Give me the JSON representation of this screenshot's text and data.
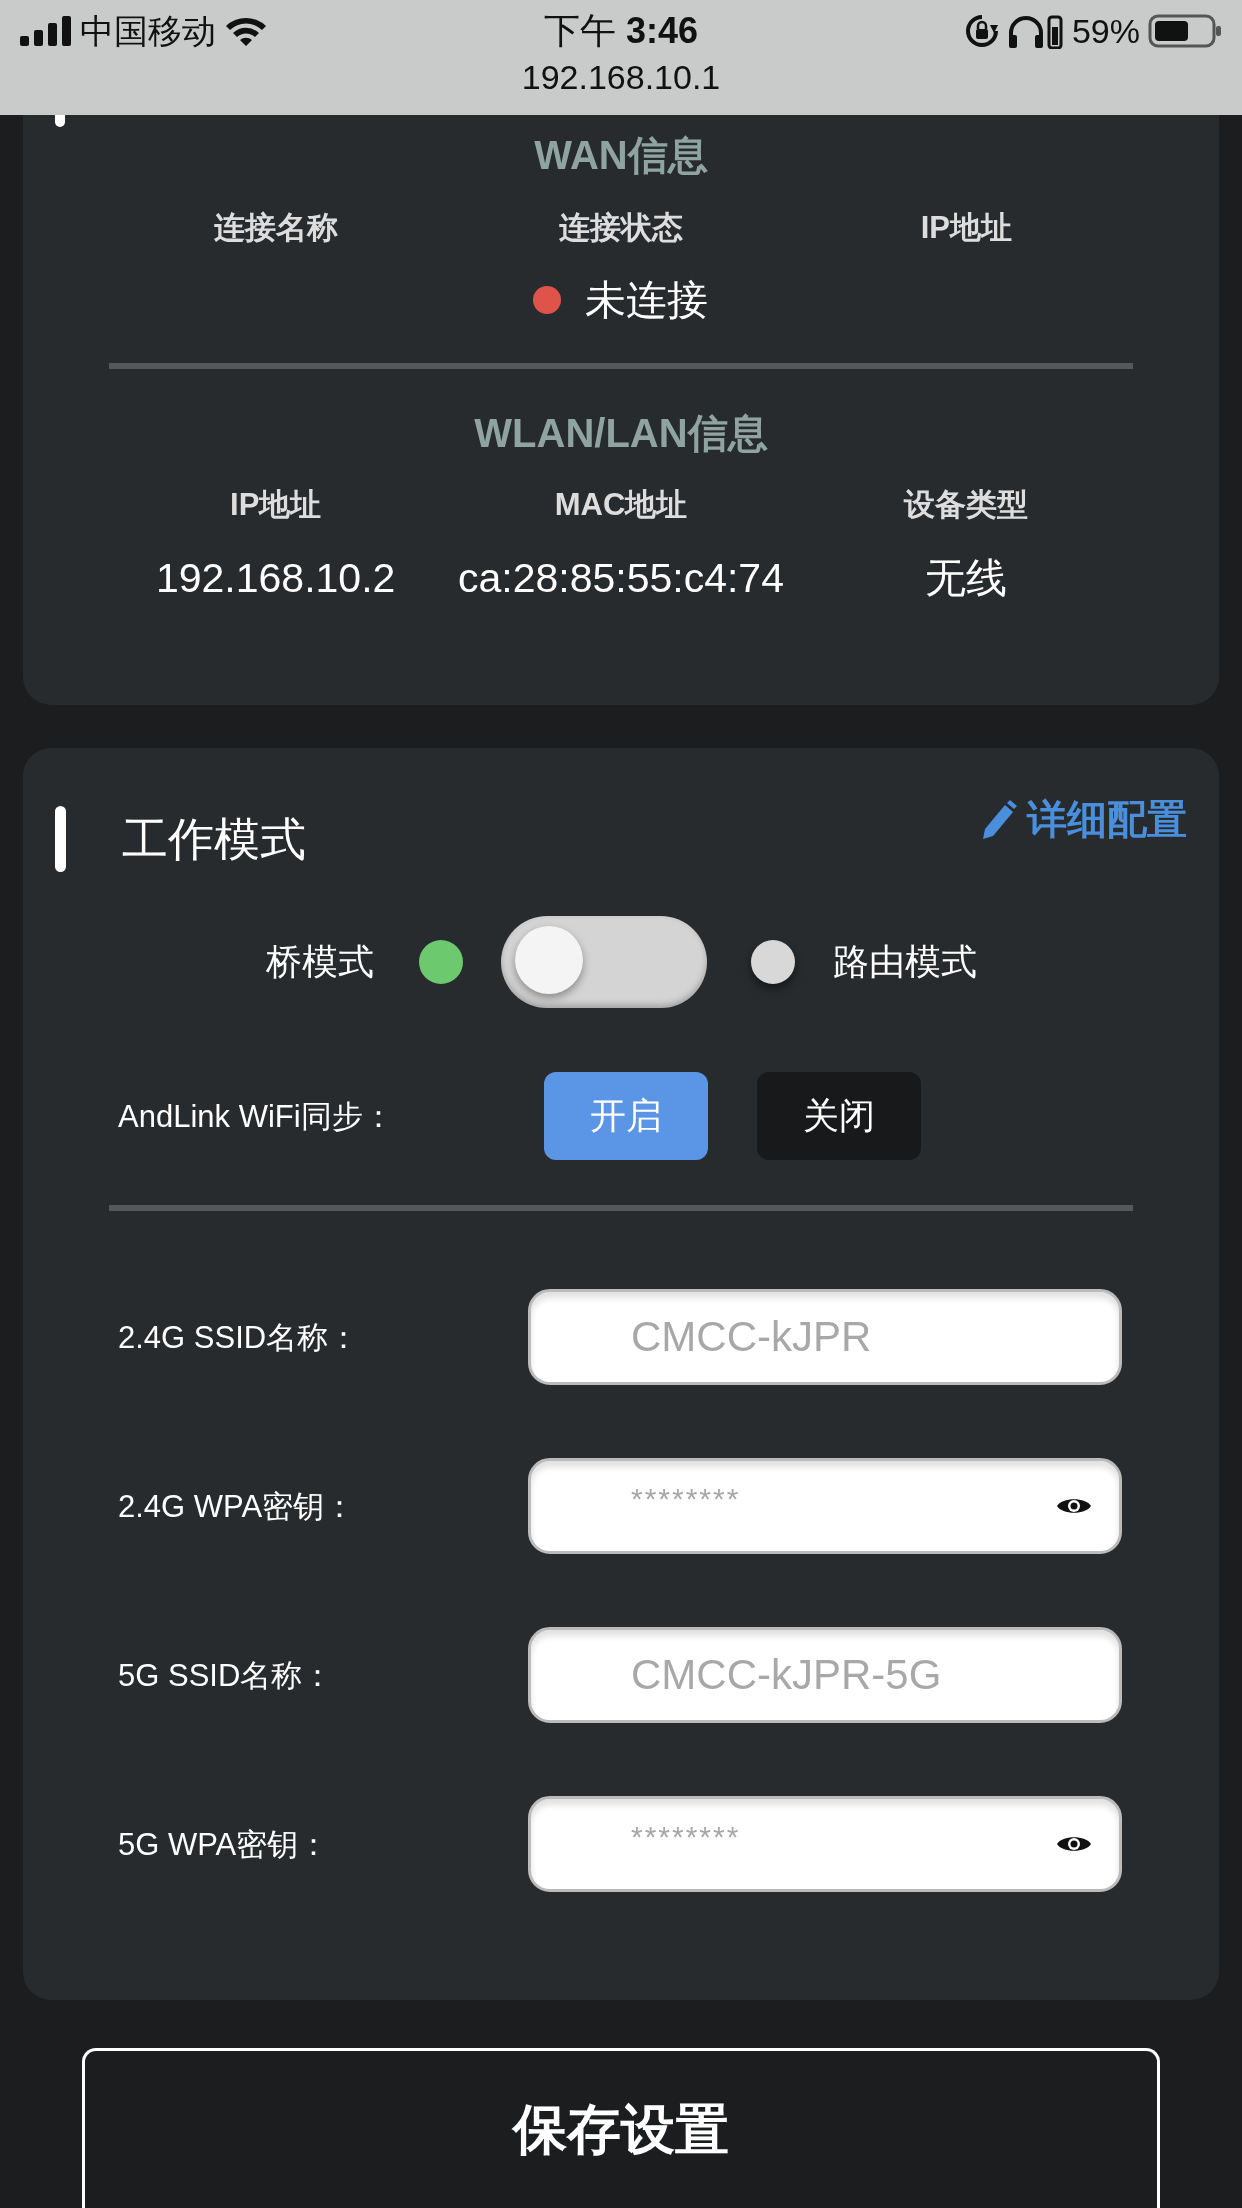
{
  "status_bar": {
    "carrier": "中国移动",
    "time": "下午 **3:46**",
    "url": "192.168.10.1",
    "battery": "59%"
  },
  "wan": {
    "title": "WAN信息",
    "columns": [
      "连接名称",
      "连接状态",
      "IP地址"
    ],
    "connection_status": {
      "text": "未连接",
      "color": "#e0534a"
    }
  },
  "lan": {
    "title": "WLAN/LAN信息",
    "columns": [
      "IP地址",
      "MAC地址",
      "设备类型"
    ],
    "values": [
      "192.168.10.2",
      "ca:28:85:55:c4:74",
      "无线"
    ]
  },
  "work_mode": {
    "title": "工作模式",
    "link": "详细配置",
    "modes": [
      {
        "label": "桥模式",
        "selected": true
      },
      {
        "label": "路由模式",
        "selected": false
      }
    ],
    "toggle": {
      "on": false
    },
    "andlink": {
      "label": "AndLink WiFi同步：",
      "options": [
        {
          "label": "开启",
          "selected": true
        },
        {
          "label": "关闭",
          "selected": false
        }
      ]
    },
    "fields": [
      {
        "label": "2.4G SSID名称：",
        "placeholder": "CMCC-kJPR",
        "kind": "text"
      },
      {
        "label": "2.4G WPA密钥：",
        "placeholder": "********",
        "kind": "password"
      },
      {
        "label": "5G SSID名称：",
        "placeholder": "CMCC-kJPR-5G",
        "kind": "text"
      },
      {
        "label": "5G WPA密钥：",
        "placeholder": "********",
        "kind": "password"
      }
    ]
  },
  "save_button": "保存设置"
}
